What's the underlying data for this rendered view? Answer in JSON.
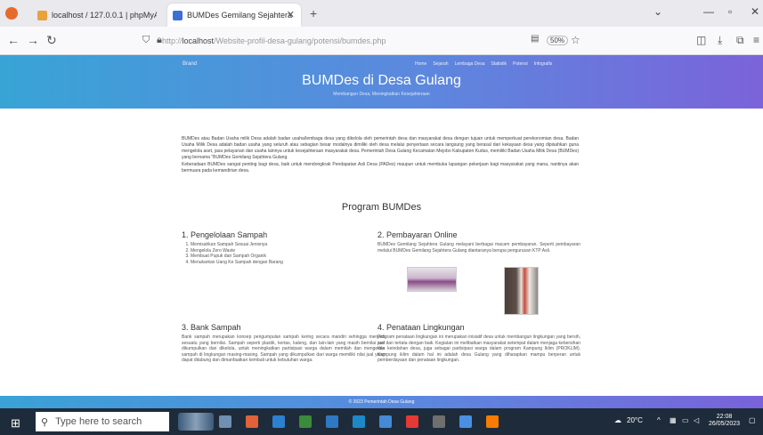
{
  "browser": {
    "tabs": [
      {
        "label": "localhost / 127.0.0.1 | phpMyA",
        "active": false,
        "favicon_color": "#e9a23b"
      },
      {
        "label": "BUMDes Gemilang Sejahtera",
        "active": true,
        "favicon_color": "#3b6fd6"
      }
    ],
    "close_glyph": "✕",
    "new_tab_glyph": "+",
    "url_prefix": "http://",
    "url_host": "localhost",
    "url_path": "/Website-profil-desa-gulang/potensi/bumdes.php",
    "zoom": "50%",
    "icons": [
      "firefox-menu-icon",
      "back-icon",
      "forward-icon",
      "reload-icon",
      "shield-icon",
      "lock-icon",
      "reader-icon",
      "star-icon",
      "pocket-icon",
      "download-icon",
      "extensions-icon",
      "menu-icon"
    ]
  },
  "site": {
    "brand": "Brand",
    "nav": [
      "Home",
      "Sejarah",
      "Lembaga Desa",
      "Statistik",
      "Potensi",
      "Infografis"
    ],
    "title": "BUMDes di Desa Gulang",
    "subtitle": "Membangun Desa, Meningkatkan Kesejahteraan",
    "intro_1": "BUMDes atau Badan Usaha milik Desa adalah badan usaha/lembaga desa yang dikelola oleh pemerintah desa dan masyarakat desa dengan tujuan untuk memperkuat perekonomian desa. Badan Usaha Milik Desa adalah badan usaha yang seluruh atau sebagian besar modalnya dimiliki oleh desa melalui penyertaan secara langsung yang berasal dari kekayaan desa yang dipisahkan guna mengelola aset, jasa pelayanan dan usaha lainnya untuk kesejahteraan masyarakat desa. Pemerintah Desa Gulang Kecamatan Mejobo Kabupaten Kudus, memiliki Badan Usaha Milik Desa (BUMDes) yang bernama \"BUMDes Gemilang Sejahtera Gulang.",
    "intro_2": "Keberadaan BUMDes sangat penting bagi desa, baik untuk mendongkrak Pendapatan Asli Desa (PADes) maupun untuk membuka lapangan pekerjaan bagi masyarakat yang mana, nantinya akan bermuara pada kemandirian desa.",
    "section_title": "Program BUMDes",
    "programs": [
      {
        "title": "1. Pengelolaan Sampah",
        "items": [
          "Memisahkan Sampah Sesuai Jenisnya",
          "Mengelola Zero Waste",
          "Membuat Pupuk dari Sampah Organik",
          "Menukarkan Uang Ke Sampah dengan Barang"
        ]
      },
      {
        "title": "2. Pembayaran Online",
        "body": "BUMDes Gemilang Sejahtera Gulang melayani berbagai macam pembayaran. Seperti pembayaran melalui BUMDes Gemilang Sejahtera Gulang diantaranya berupa pengurusan KTP Asli."
      },
      {
        "title": "3. Bank Sampah",
        "body": "Bank sampah merupakan konsep pengumpulan sampah kering secara mandiri sehingga menjadi sesuatu yang bernilai. Sampah seperti plastik, kertas, kaleng, dan lain-lain yang masih bernilai jual dikumpulkan dan dikelola, untuk meningkatkan partisipasi warga dalam memilah dan mengelola sampah di lingkungan masing-masing. Sampah yang dikumpulkan dari warga memiliki nilai jual yang dapat ditabung dan dimanfaatkan kembali untuk kebutuhan warga."
      },
      {
        "title": "4. Penataan Lingkungan",
        "body": "Program penataan lingkungan ini merupakan inisiatif desa untuk membangun lingkungan yang bersih, asri dan tertata dengan baik. Kegiatan ini melibatkan masyarakat setempat dalam menjaga kebersihan dan keindahan desa, juga sebagai partisipasi warga dalam program Kampung Iklim (PROKLIM). Kampung iklim dalam hal ini adalah desa Gulang yang diharapkan mampu berperan untuk pemberdayaan dan penataan lingkungan."
      }
    ],
    "footer": "© 2023 Pemerintah Desa Gulang"
  },
  "taskbar": {
    "search_placeholder": "Type here to search",
    "weather": "20°C",
    "time": "22:08",
    "date": "26/05/2023",
    "app_colors": [
      "#6f8fb3",
      "#e0623a",
      "#2d7fd0",
      "#3c8a3c",
      "#2f78c4",
      "#1e88c7",
      "#4689d6",
      "#e53935",
      "#6f6f6f",
      "#4a90e2",
      "#f57c00"
    ]
  }
}
